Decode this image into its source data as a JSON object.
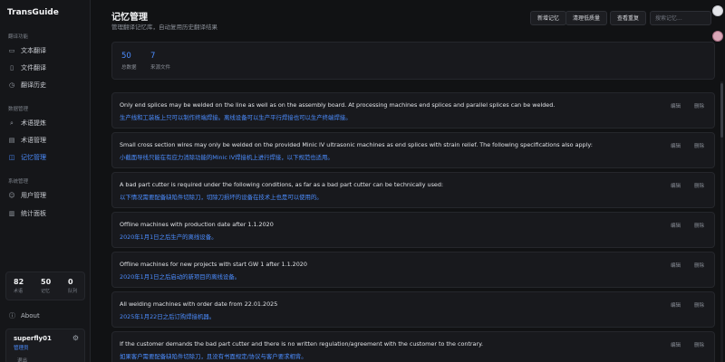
{
  "app": {
    "brand": "TransGuide"
  },
  "sidebar": {
    "sections": [
      {
        "label": "翻译功能"
      },
      {
        "label": "数据管理"
      },
      {
        "label": "系统管理"
      }
    ],
    "items": [
      {
        "label": "文本翻译",
        "icon": "chat-icon",
        "active": false
      },
      {
        "label": "文件翻译",
        "icon": "file-icon",
        "active": false
      },
      {
        "label": "翻译历史",
        "icon": "history-icon",
        "active": false
      },
      {
        "label": "术语提炼",
        "icon": "extract-icon",
        "active": false
      },
      {
        "label": "术语管理",
        "icon": "book-icon",
        "active": false
      },
      {
        "label": "记忆管理",
        "icon": "memory-icon",
        "active": true
      },
      {
        "label": "用户管理",
        "icon": "users-icon",
        "active": false
      },
      {
        "label": "统计面板",
        "icon": "chart-icon",
        "active": false
      }
    ],
    "stats": [
      {
        "value": "82",
        "label": "术语"
      },
      {
        "value": "50",
        "label": "记忆"
      },
      {
        "value": "0",
        "label": "队列"
      }
    ],
    "about": "About",
    "user": {
      "name": "superfly01",
      "role": "管理员",
      "logout": "退出"
    }
  },
  "header": {
    "title": "记忆管理",
    "subtitle": "管理翻译记忆库，自动复用历史翻译结果",
    "buttons": [
      "新增记忆",
      "清理低质量",
      "查看重复"
    ],
    "search_placeholder": "搜索记忆..."
  },
  "summary": [
    {
      "value": "50",
      "label": "总数据"
    },
    {
      "value": "7",
      "label": "来源文件"
    }
  ],
  "row_actions": {
    "edit": "编辑",
    "delete": "删除"
  },
  "memories": [
    {
      "source": "Only end splices may be welded on the line as well as on the assembly board. At processing machines end splices and parallel splices can be welded.",
      "target": "生产线和工装板上只可以制作终端焊接。离线设备可以生产平行焊接也可以生产终端焊接。"
    },
    {
      "source": "Small cross section wires may only be welded on the provided Minic IV ultrasonic machines as end splices with strain relief. The following specifications also apply:",
      "target": "小截面导线只能在有应力消除功能的Minic IV焊接机上进行焊接，以下规范也适用。"
    },
    {
      "source": "A bad part cutter is required under the following conditions, as far as a bad part cutter can be technically used:",
      "target": "以下情况需要配备缺陷件切除刀，切除刀损坏的设备在技术上也是可以使用的。"
    },
    {
      "source": "Offline machines with production date after 1.1.2020",
      "target": "2020年1月1日之后生产的离线设备。"
    },
    {
      "source": "Offline machines for new projects with start GW 1 after 1.1.2020",
      "target": "2020年1月1日之后启动的新项目的离线设备。"
    },
    {
      "source": "All welding machines with order date from 22.01.2025",
      "target": "2025年1月22日之后订购焊接机器。"
    },
    {
      "source": "If the customer demands the bad part cutter and there is no written regulation/agreement with the customer to the contrary.",
      "target": "如果客户需要配备缺陷件切除刀，且没有书面规定/协议与客户要求相背。"
    }
  ]
}
